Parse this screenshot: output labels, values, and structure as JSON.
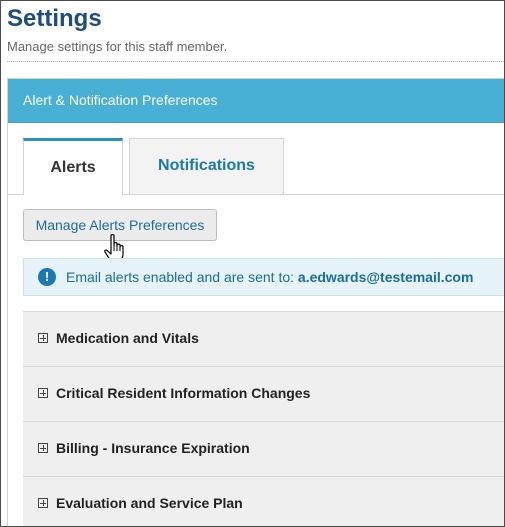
{
  "page": {
    "title": "Settings",
    "subtitle": "Manage settings for this staff member."
  },
  "panel": {
    "header": "Alert & Notification Preferences"
  },
  "tabs": [
    {
      "label": "Alerts",
      "active": true
    },
    {
      "label": "Notifications",
      "active": false
    }
  ],
  "manage_button": {
    "label": "Manage Alerts Preferences"
  },
  "info_alert": {
    "icon": "info-circle-icon",
    "message": "Email alerts enabled and are sent to:",
    "email": "a.edwards@testemail.com"
  },
  "accordion": [
    {
      "label": "Medication and Vitals"
    },
    {
      "label": "Critical Resident Information Changes"
    },
    {
      "label": "Billing - Insurance Expiration"
    },
    {
      "label": "Evaluation and Service Plan"
    }
  ],
  "colors": {
    "title": "#1d4e79",
    "panel_header": "#47b0d4",
    "tab_active_border": "#2a90c4",
    "link": "#1a7aaa"
  }
}
